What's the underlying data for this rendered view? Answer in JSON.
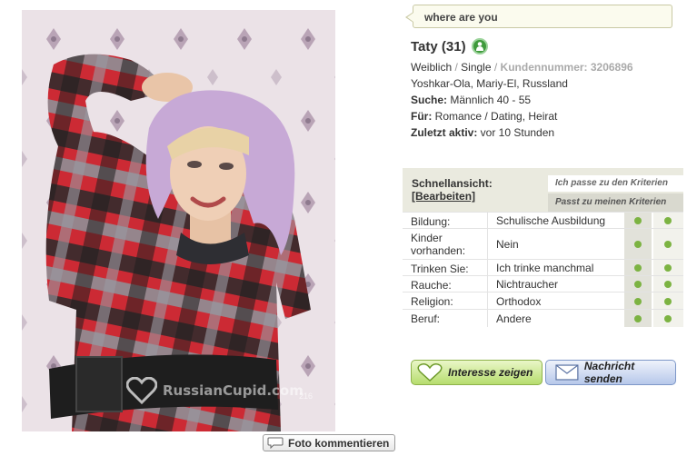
{
  "bubble": {
    "text": "where are you"
  },
  "profile": {
    "name": "Taty (31)",
    "gender": "Weiblich",
    "slash1": " / ",
    "status": "Single",
    "slash2": " / ",
    "customer_label": "Kundennummer: 3206896",
    "location": "Yoshkar-Ola, Mariy-El, Russland",
    "search_label": "Suche:",
    "search_value": " Männlich 40 - 55",
    "for_label": "Für:",
    "for_value": " Romance / Dating, Heirat",
    "active_label": "Zuletzt aktiv:",
    "active_value": " vor 10 Stunden"
  },
  "quickview": {
    "title": "Schnellansicht:",
    "edit": "[Bearbeiten]",
    "criteria_1": "Ich passe zu den Kriterien",
    "criteria_2": "Passt zu meinen Kriterien",
    "rows": [
      {
        "label": "Bildung:",
        "value": "Schulische Ausbildung",
        "match1": true,
        "match2": true
      },
      {
        "label": "Kinder vorhanden:",
        "value": "Nein",
        "match1": true,
        "match2": true
      },
      {
        "label": "Trinken Sie:",
        "value": "Ich trinke manchmal",
        "match1": true,
        "match2": true
      },
      {
        "label": "Rauche:",
        "value": "Nichtraucher",
        "match1": true,
        "match2": true
      },
      {
        "label": "Religion:",
        "value": "Orthodox",
        "match1": true,
        "match2": true
      },
      {
        "label": "Beruf:",
        "value": "Andere",
        "match1": true,
        "match2": true
      }
    ]
  },
  "buttons": {
    "interest": "Interesse zeigen",
    "message": "Nachricht senden",
    "comment": "Foto kommentieren"
  },
  "watermark": {
    "text": "RussianCupid.com",
    "number": "216"
  },
  "colors": {
    "online": "#3f9a3c",
    "match_dot": "#7cb342",
    "interest": "#b6dd6e",
    "message": "#b7c8ea"
  },
  "icons": {
    "online": "person-online-icon",
    "comment": "speech-bubble-icon",
    "interest": "heart-icon",
    "message": "envelope-icon"
  }
}
